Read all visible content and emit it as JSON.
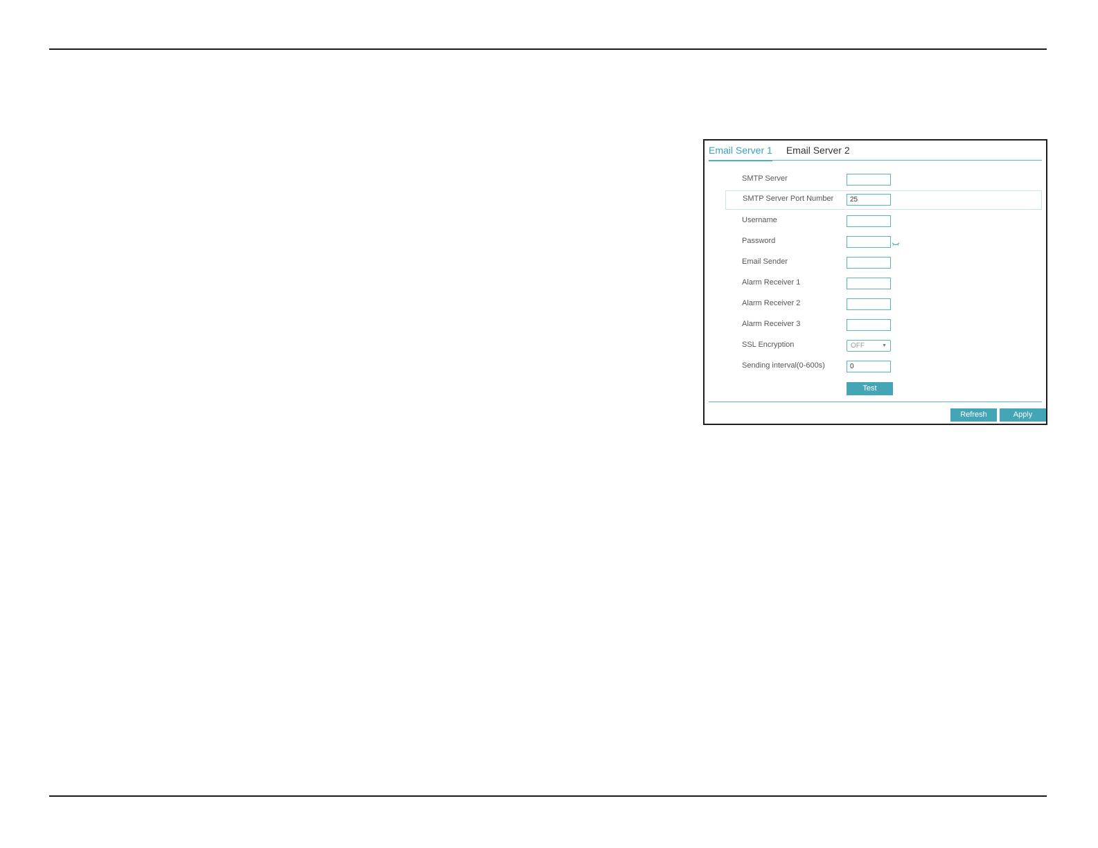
{
  "tabs": [
    {
      "label": "Email Server 1",
      "active": true
    },
    {
      "label": "Email Server 2",
      "active": false
    }
  ],
  "fields": {
    "smtp_server": {
      "label": "SMTP Server",
      "value": ""
    },
    "smtp_port": {
      "label": "SMTP Server Port Number",
      "value": "25"
    },
    "username": {
      "label": "Username",
      "value": ""
    },
    "password": {
      "label": "Password",
      "value": ""
    },
    "email_sender": {
      "label": "Email Sender",
      "value": ""
    },
    "alarm_receiver_1": {
      "label": "Alarm Receiver 1",
      "value": ""
    },
    "alarm_receiver_2": {
      "label": "Alarm Receiver 2",
      "value": ""
    },
    "alarm_receiver_3": {
      "label": "Alarm Receiver 3",
      "value": ""
    },
    "ssl_encryption": {
      "label": "SSL Encryption",
      "selected": "OFF"
    },
    "sending_interval": {
      "label": "Sending interval(0-600s)",
      "value": "0"
    }
  },
  "buttons": {
    "test": "Test",
    "refresh": "Refresh",
    "apply": "Apply"
  },
  "colors": {
    "accent": "#44a5b6",
    "tab_active": "#3aa3b4",
    "field_border": "#55b3c2"
  }
}
